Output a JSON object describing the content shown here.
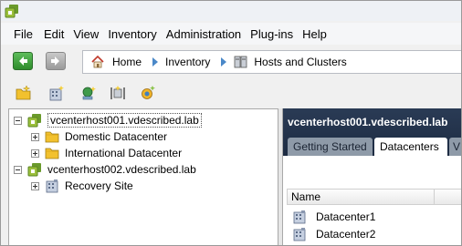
{
  "window": {
    "app_icon": "vsphere-client-icon"
  },
  "menu": {
    "items": [
      "File",
      "Edit",
      "View",
      "Inventory",
      "Administration",
      "Plug-ins",
      "Help"
    ]
  },
  "nav": {
    "back_icon": "back-arrow-icon",
    "forward_icon": "forward-arrow-icon",
    "breadcrumb": [
      {
        "label": "Home",
        "icon": "home-icon"
      },
      {
        "label": "Inventory",
        "icon": ""
      },
      {
        "label": "Hosts and Clusters",
        "icon": "hosts-clusters-icon"
      }
    ]
  },
  "toolbar": {
    "icons": [
      "new-folder-icon",
      "new-datacenter-icon",
      "add-host-icon",
      "new-cluster-icon",
      "new-resource-icon"
    ]
  },
  "tree": {
    "vcenter1": "vcenterhost001.vdescribed.lab",
    "domestic": "Domestic Datacenter",
    "international": "International Datacenter",
    "vcenter2": "vcenterhost002.vdescribed.lab",
    "recovery": "Recovery Site"
  },
  "right": {
    "title": "vcenterhost001.vdescribed.lab",
    "tabs": [
      "Getting Started",
      "Datacenters",
      "V"
    ],
    "active_tab": "Datacenters",
    "column_name": "Name",
    "rows": [
      "Datacenter1",
      "Datacenter2"
    ]
  },
  "colors": {
    "header_bg": "#1d2b42",
    "tab_inactive": "#8e9aa8",
    "folder": "#f2c12e",
    "vcenter": "#9bbf3b"
  }
}
